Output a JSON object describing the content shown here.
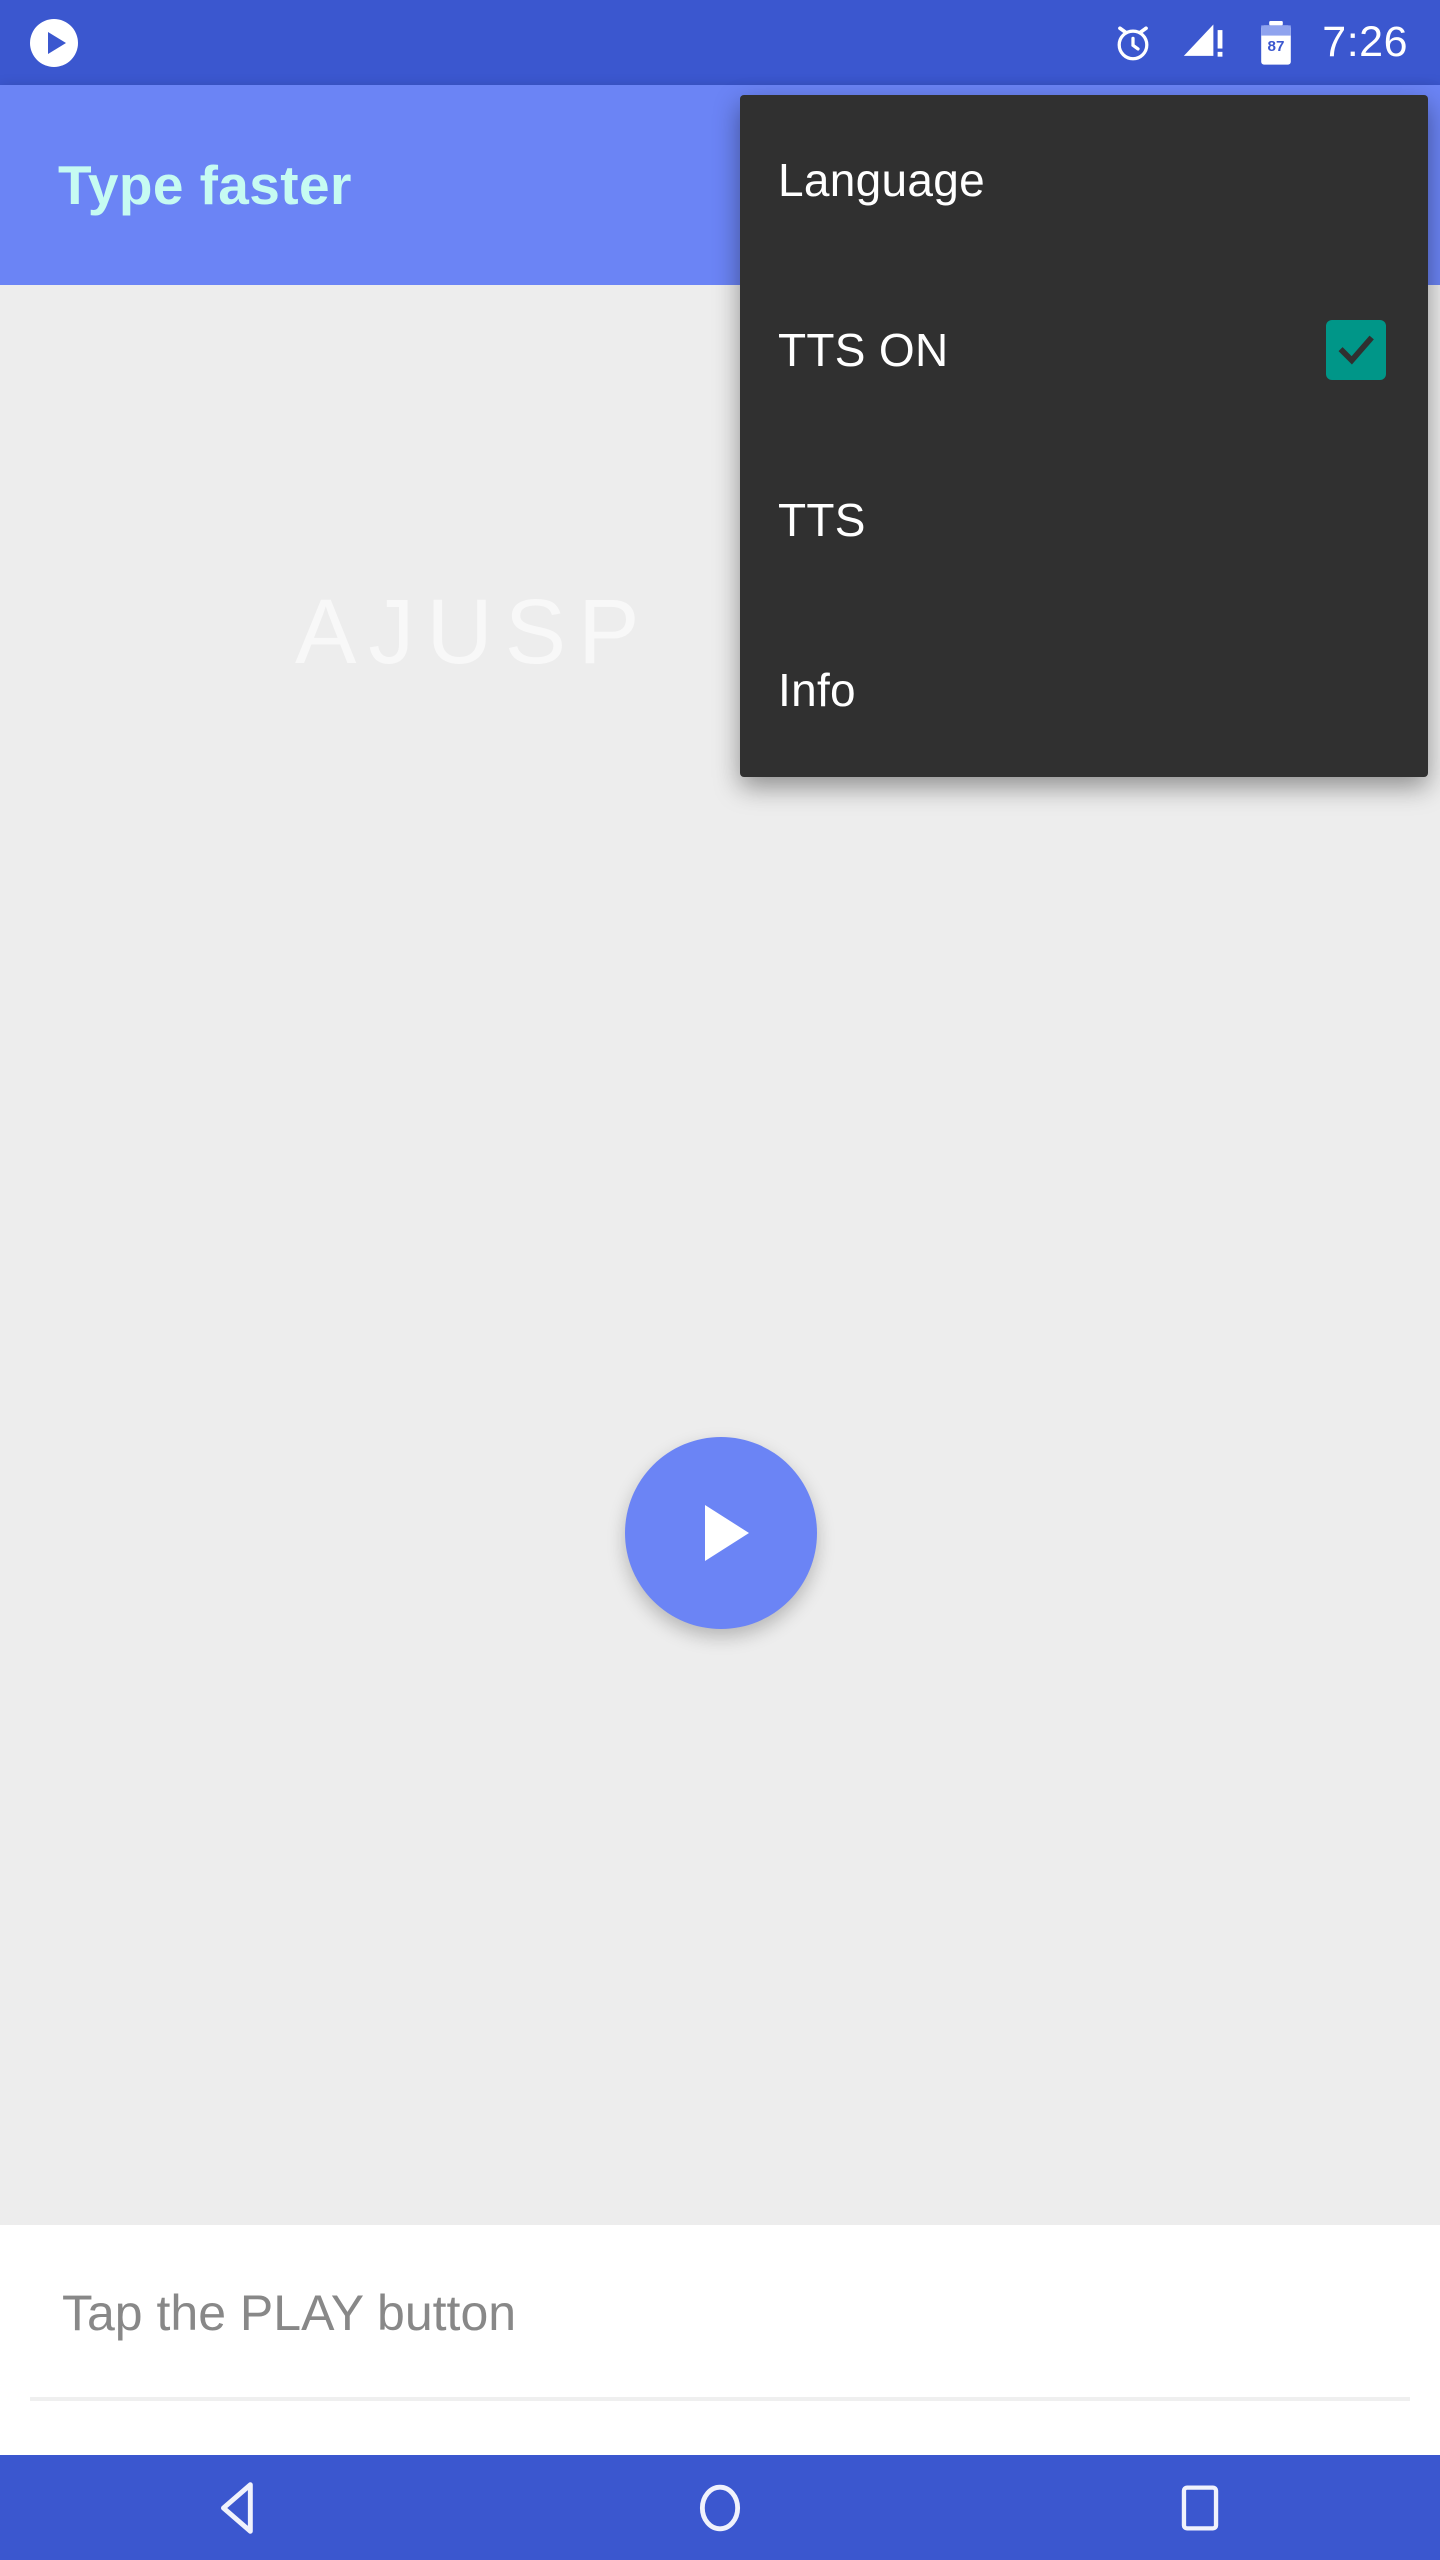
{
  "status_bar": {
    "notification_icon": "play-circle-icon",
    "alarm_icon": "alarm-clock-icon",
    "signal_icon": "signal-bars-warning-icon",
    "battery_icon": "battery-icon",
    "battery_level": "87",
    "time": "7:26",
    "background_color": "#3B57CF"
  },
  "app_bar": {
    "title": "Type faster",
    "background_color": "#6B84F5",
    "title_color": "#C6FBF2"
  },
  "content": {
    "watermark_text": "AJUSP",
    "background_color": "#EDEDED",
    "play_button": {
      "icon": "play-icon",
      "color": "#6B84F5"
    }
  },
  "input_bar": {
    "placeholder": "Tap the PLAY button",
    "value": "",
    "background_color": "#FFFFFF"
  },
  "overflow_menu": {
    "background_color": "#303030",
    "items": [
      {
        "label": "Language",
        "checked": false
      },
      {
        "label": "TTS ON",
        "checked": true
      },
      {
        "label": "TTS",
        "checked": false
      },
      {
        "label": "Info",
        "checked": false
      }
    ],
    "checkbox_color": "#009688"
  },
  "nav_bar": {
    "background_color": "#3B57CF",
    "back_label": "back-icon",
    "home_label": "home-icon",
    "recents_label": "recents-icon"
  }
}
